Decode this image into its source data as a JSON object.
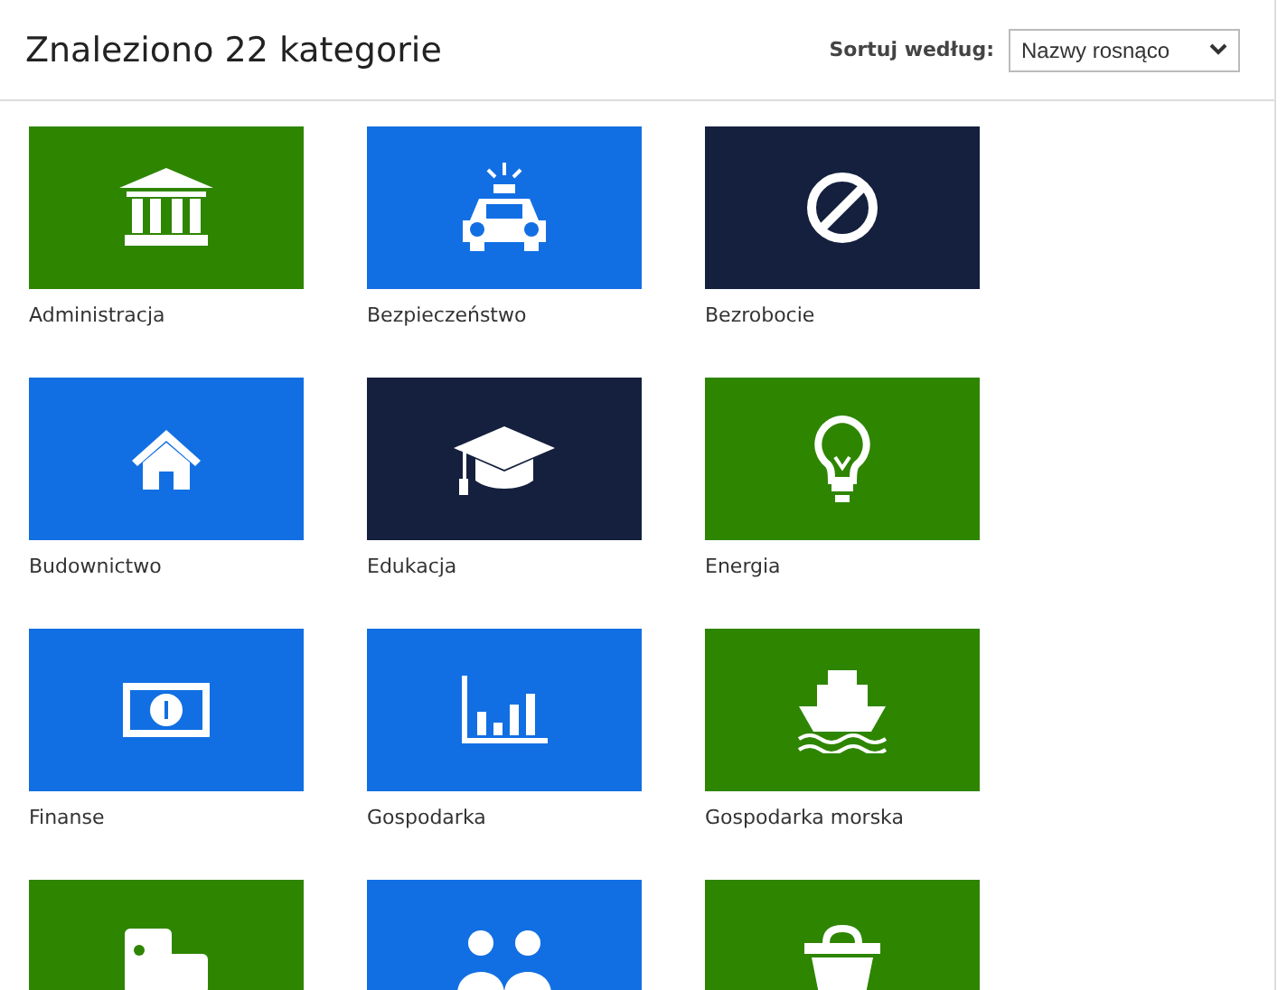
{
  "header": {
    "title": "Znaleziono 22 kategorie",
    "sort_label": "Sortuj według:",
    "sort_value": "Nazwy rosnąco"
  },
  "categories": [
    {
      "label": "Administracja",
      "color": "#2e8500"
    },
    {
      "label": "Bezpieczeństwo",
      "color": "#126fe3"
    },
    {
      "label": "Bezrobocie",
      "color": "#14203d"
    },
    {
      "label": "Budownictwo",
      "color": "#126fe3"
    },
    {
      "label": "Edukacja",
      "color": "#14203d"
    },
    {
      "label": "Energia",
      "color": "#2e8500"
    },
    {
      "label": "Finanse",
      "color": "#126fe3"
    },
    {
      "label": "Gospodarka",
      "color": "#126fe3"
    },
    {
      "label": "Gospodarka morska",
      "color": "#2e8500"
    },
    {
      "color": "#2e8500"
    },
    {
      "color": "#126fe3"
    },
    {
      "color": "#2e8500"
    }
  ]
}
